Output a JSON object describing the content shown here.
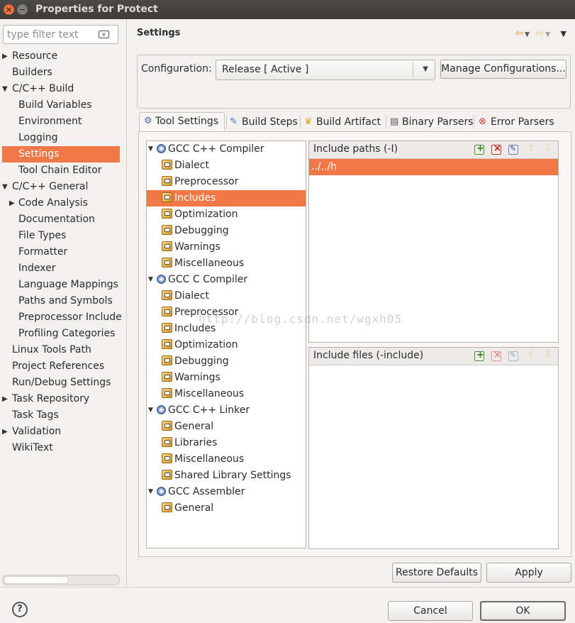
{
  "window": {
    "title": "Properties for Protect"
  },
  "filter": {
    "placeholder": "type filter text"
  },
  "nav": {
    "items": [
      {
        "label": "Resource",
        "level": 0,
        "arrow": "▶"
      },
      {
        "label": "Builders",
        "level": 0,
        "arrow": ""
      },
      {
        "label": "C/C++ Build",
        "level": 0,
        "arrow": "▼"
      },
      {
        "label": "Build Variables",
        "level": 1,
        "arrow": ""
      },
      {
        "label": "Environment",
        "level": 1,
        "arrow": ""
      },
      {
        "label": "Logging",
        "level": 1,
        "arrow": ""
      },
      {
        "label": "Settings",
        "level": 1,
        "arrow": "",
        "selected": true
      },
      {
        "label": "Tool Chain Editor",
        "level": 1,
        "arrow": ""
      },
      {
        "label": "C/C++ General",
        "level": 0,
        "arrow": "▼"
      },
      {
        "label": "Code Analysis",
        "level": 1,
        "arrow": "▶"
      },
      {
        "label": "Documentation",
        "level": 1,
        "arrow": ""
      },
      {
        "label": "File Types",
        "level": 1,
        "arrow": ""
      },
      {
        "label": "Formatter",
        "level": 1,
        "arrow": ""
      },
      {
        "label": "Indexer",
        "level": 1,
        "arrow": ""
      },
      {
        "label": "Language Mappings",
        "level": 1,
        "arrow": ""
      },
      {
        "label": "Paths and Symbols",
        "level": 1,
        "arrow": ""
      },
      {
        "label": "Preprocessor Include",
        "level": 1,
        "arrow": ""
      },
      {
        "label": "Profiling Categories",
        "level": 1,
        "arrow": ""
      },
      {
        "label": "Linux Tools Path",
        "level": 0,
        "arrow": ""
      },
      {
        "label": "Project References",
        "level": 0,
        "arrow": ""
      },
      {
        "label": "Run/Debug Settings",
        "level": 0,
        "arrow": ""
      },
      {
        "label": "Task Repository",
        "level": 0,
        "arrow": "▶"
      },
      {
        "label": "Task Tags",
        "level": 0,
        "arrow": ""
      },
      {
        "label": "Validation",
        "level": 0,
        "arrow": "▶"
      },
      {
        "label": "WikiText",
        "level": 0,
        "arrow": ""
      }
    ]
  },
  "header": {
    "title": "Settings"
  },
  "config": {
    "label": "Configuration:",
    "selected": "Release  [ Active ]",
    "manage_label": "Manage Configurations..."
  },
  "tabs": [
    {
      "label": "Tool Settings",
      "icon": "tool-settings-icon",
      "active": true
    },
    {
      "label": "Build Steps",
      "icon": "build-steps-icon"
    },
    {
      "label": "Build Artifact",
      "icon": "build-artifact-icon"
    },
    {
      "label": "Binary Parsers",
      "icon": "binary-parsers-icon"
    },
    {
      "label": "Error Parsers",
      "icon": "error-parsers-icon"
    }
  ],
  "tree": [
    {
      "label": "GCC C++ Compiler",
      "type": "tool",
      "children": [
        "Dialect",
        "Preprocessor",
        "Includes",
        "Optimization",
        "Debugging",
        "Warnings",
        "Miscellaneous"
      ]
    },
    {
      "label": "GCC C Compiler",
      "type": "tool",
      "children": [
        "Dialect",
        "Preprocessor",
        "Includes",
        "Optimization",
        "Debugging",
        "Warnings",
        "Miscellaneous"
      ]
    },
    {
      "label": "GCC C++ Linker",
      "type": "tool",
      "children": [
        "General",
        "Libraries",
        "Miscellaneous",
        "Shared Library Settings"
      ]
    },
    {
      "label": "GCC Assembler",
      "type": "tool",
      "children": [
        "General"
      ]
    }
  ],
  "tree_selected": "GCC C++ Compiler/Includes",
  "include_paths": {
    "title": "Include paths (-I)",
    "items": [
      "../../h"
    ]
  },
  "include_files": {
    "title": "Include files (-include)",
    "items": []
  },
  "watermark": "http://blog.csdn.net/wgxh05",
  "buttons": {
    "restore_defaults": "Restore Defaults",
    "apply": "Apply",
    "cancel": "Cancel",
    "ok": "OK"
  },
  "colors": {
    "selection": "#f07746",
    "titlebar": "#3c3b37"
  }
}
